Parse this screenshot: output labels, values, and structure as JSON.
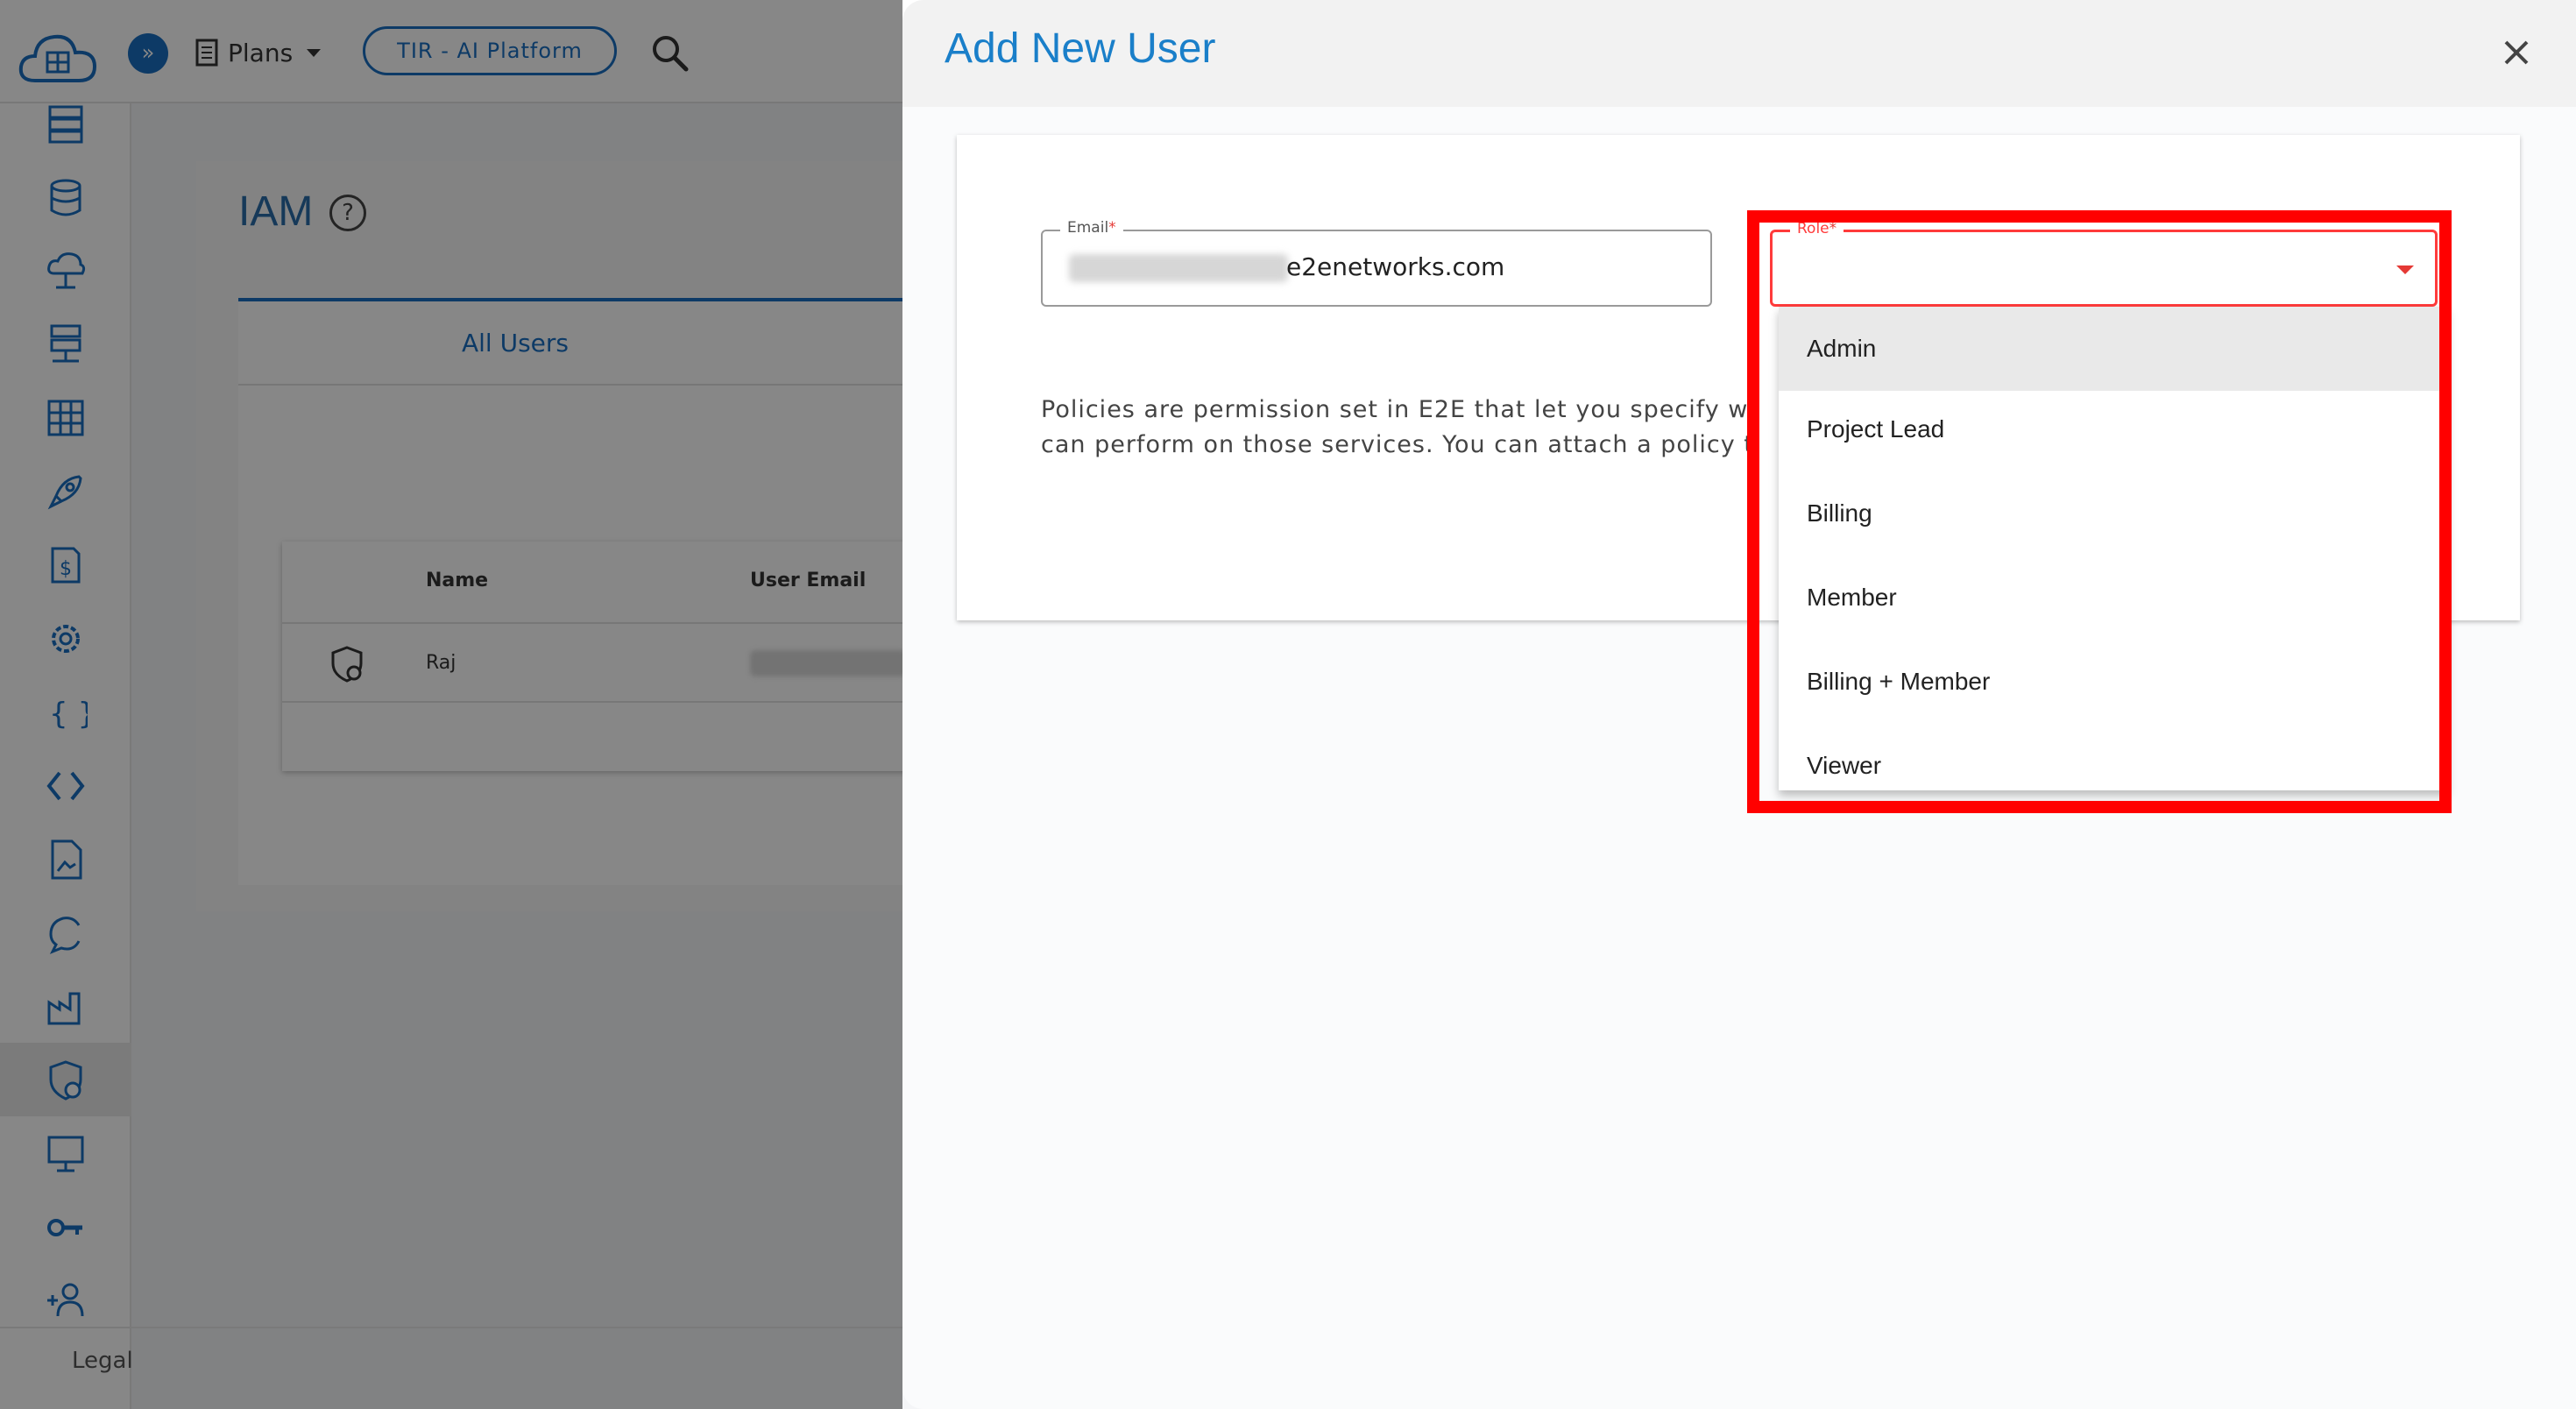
{
  "topbar": {
    "plans_label": "Plans",
    "platform_label": "TIR - AI Platform"
  },
  "iam": {
    "title": "IAM",
    "tab_all_users": "All Users",
    "table": {
      "columns": [
        "Name",
        "User Email"
      ],
      "rows": [
        {
          "name": "Raj"
        }
      ]
    }
  },
  "sidebar": {
    "legal": "Legal"
  },
  "dialog": {
    "title": "Add New User",
    "email_label": "Email",
    "email_required_mark": "*",
    "email_value": "e2enetworks.com",
    "role_label": "Role",
    "role_required_mark": "*",
    "policy_line1": "Policies are permission set in E2E that let you specify w",
    "policy_line2": "can perform on those services. You can attach a policy t",
    "role_options": [
      "Admin",
      "Project Lead",
      "Billing",
      "Member",
      "Billing + Member",
      "Viewer"
    ],
    "highlighted_option": "Admin"
  },
  "colors": {
    "accent": "#1a7fc9",
    "required": "#e53935",
    "annotation": "#ff0000"
  }
}
